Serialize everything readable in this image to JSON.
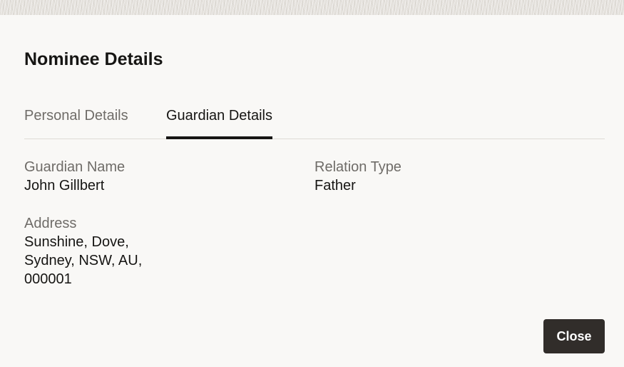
{
  "dialog": {
    "title": "Nominee Details"
  },
  "tabs": [
    {
      "label": "Personal Details",
      "selected": false
    },
    {
      "label": "Guardian Details",
      "selected": true
    }
  ],
  "guardian": {
    "name_label": "Guardian Name",
    "name_value": "John Gillbert",
    "relation_label": "Relation Type",
    "relation_value": "Father",
    "address_label": "Address",
    "address_value": "Sunshine, Dove, Sydney, NSW, AU, 000001"
  },
  "footer": {
    "close_label": "Close"
  },
  "colors": {
    "background": "#f9f8f6",
    "primary_text": "#161513",
    "secondary_text": "#6f6c68",
    "button_bg": "#312d2a"
  }
}
